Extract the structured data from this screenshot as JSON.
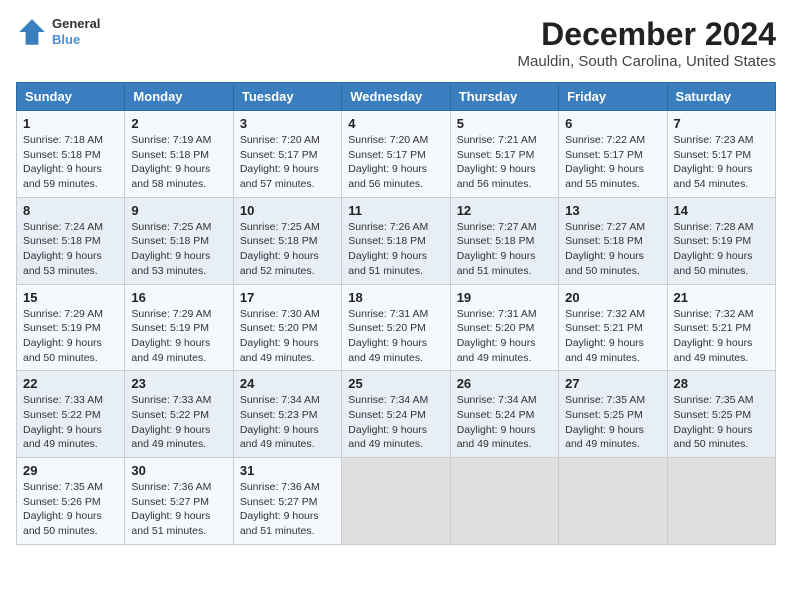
{
  "header": {
    "logo_line1": "General",
    "logo_line2": "Blue",
    "title": "December 2024",
    "subtitle": "Mauldin, South Carolina, United States"
  },
  "days_of_week": [
    "Sunday",
    "Monday",
    "Tuesday",
    "Wednesday",
    "Thursday",
    "Friday",
    "Saturday"
  ],
  "weeks": [
    [
      {
        "day": 1,
        "sunrise": "7:18 AM",
        "sunset": "5:18 PM",
        "daylight": "9 hours and 59 minutes."
      },
      {
        "day": 2,
        "sunrise": "7:19 AM",
        "sunset": "5:18 PM",
        "daylight": "9 hours and 58 minutes."
      },
      {
        "day": 3,
        "sunrise": "7:20 AM",
        "sunset": "5:17 PM",
        "daylight": "9 hours and 57 minutes."
      },
      {
        "day": 4,
        "sunrise": "7:20 AM",
        "sunset": "5:17 PM",
        "daylight": "9 hours and 56 minutes."
      },
      {
        "day": 5,
        "sunrise": "7:21 AM",
        "sunset": "5:17 PM",
        "daylight": "9 hours and 56 minutes."
      },
      {
        "day": 6,
        "sunrise": "7:22 AM",
        "sunset": "5:17 PM",
        "daylight": "9 hours and 55 minutes."
      },
      {
        "day": 7,
        "sunrise": "7:23 AM",
        "sunset": "5:17 PM",
        "daylight": "9 hours and 54 minutes."
      }
    ],
    [
      {
        "day": 8,
        "sunrise": "7:24 AM",
        "sunset": "5:18 PM",
        "daylight": "9 hours and 53 minutes."
      },
      {
        "day": 9,
        "sunrise": "7:25 AM",
        "sunset": "5:18 PM",
        "daylight": "9 hours and 53 minutes."
      },
      {
        "day": 10,
        "sunrise": "7:25 AM",
        "sunset": "5:18 PM",
        "daylight": "9 hours and 52 minutes."
      },
      {
        "day": 11,
        "sunrise": "7:26 AM",
        "sunset": "5:18 PM",
        "daylight": "9 hours and 51 minutes."
      },
      {
        "day": 12,
        "sunrise": "7:27 AM",
        "sunset": "5:18 PM",
        "daylight": "9 hours and 51 minutes."
      },
      {
        "day": 13,
        "sunrise": "7:27 AM",
        "sunset": "5:18 PM",
        "daylight": "9 hours and 50 minutes."
      },
      {
        "day": 14,
        "sunrise": "7:28 AM",
        "sunset": "5:19 PM",
        "daylight": "9 hours and 50 minutes."
      }
    ],
    [
      {
        "day": 15,
        "sunrise": "7:29 AM",
        "sunset": "5:19 PM",
        "daylight": "9 hours and 50 minutes."
      },
      {
        "day": 16,
        "sunrise": "7:29 AM",
        "sunset": "5:19 PM",
        "daylight": "9 hours and 49 minutes."
      },
      {
        "day": 17,
        "sunrise": "7:30 AM",
        "sunset": "5:20 PM",
        "daylight": "9 hours and 49 minutes."
      },
      {
        "day": 18,
        "sunrise": "7:31 AM",
        "sunset": "5:20 PM",
        "daylight": "9 hours and 49 minutes."
      },
      {
        "day": 19,
        "sunrise": "7:31 AM",
        "sunset": "5:20 PM",
        "daylight": "9 hours and 49 minutes."
      },
      {
        "day": 20,
        "sunrise": "7:32 AM",
        "sunset": "5:21 PM",
        "daylight": "9 hours and 49 minutes."
      },
      {
        "day": 21,
        "sunrise": "7:32 AM",
        "sunset": "5:21 PM",
        "daylight": "9 hours and 49 minutes."
      }
    ],
    [
      {
        "day": 22,
        "sunrise": "7:33 AM",
        "sunset": "5:22 PM",
        "daylight": "9 hours and 49 minutes."
      },
      {
        "day": 23,
        "sunrise": "7:33 AM",
        "sunset": "5:22 PM",
        "daylight": "9 hours and 49 minutes."
      },
      {
        "day": 24,
        "sunrise": "7:34 AM",
        "sunset": "5:23 PM",
        "daylight": "9 hours and 49 minutes."
      },
      {
        "day": 25,
        "sunrise": "7:34 AM",
        "sunset": "5:24 PM",
        "daylight": "9 hours and 49 minutes."
      },
      {
        "day": 26,
        "sunrise": "7:34 AM",
        "sunset": "5:24 PM",
        "daylight": "9 hours and 49 minutes."
      },
      {
        "day": 27,
        "sunrise": "7:35 AM",
        "sunset": "5:25 PM",
        "daylight": "9 hours and 49 minutes."
      },
      {
        "day": 28,
        "sunrise": "7:35 AM",
        "sunset": "5:25 PM",
        "daylight": "9 hours and 50 minutes."
      }
    ],
    [
      {
        "day": 29,
        "sunrise": "7:35 AM",
        "sunset": "5:26 PM",
        "daylight": "9 hours and 50 minutes."
      },
      {
        "day": 30,
        "sunrise": "7:36 AM",
        "sunset": "5:27 PM",
        "daylight": "9 hours and 51 minutes."
      },
      {
        "day": 31,
        "sunrise": "7:36 AM",
        "sunset": "5:27 PM",
        "daylight": "9 hours and 51 minutes."
      },
      null,
      null,
      null,
      null
    ]
  ]
}
